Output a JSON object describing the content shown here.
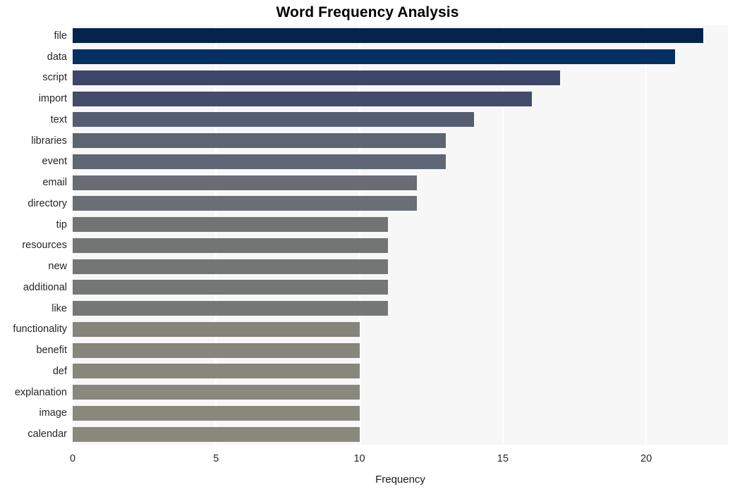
{
  "chart_data": {
    "type": "bar",
    "orientation": "horizontal",
    "title": "Word Frequency Analysis",
    "xlabel": "Frequency",
    "ylabel": "",
    "categories": [
      "file",
      "data",
      "script",
      "import",
      "text",
      "libraries",
      "event",
      "email",
      "directory",
      "tip",
      "resources",
      "new",
      "additional",
      "like",
      "functionality",
      "benefit",
      "def",
      "explanation",
      "image",
      "calendar"
    ],
    "values": [
      22,
      21,
      17,
      16,
      14,
      13,
      13,
      12,
      12,
      11,
      11,
      11,
      11,
      11,
      10,
      10,
      10,
      10,
      10,
      10
    ],
    "bar_colors": [
      "#04234d",
      "#032f63",
      "#3d4668",
      "#434c6b",
      "#555d72",
      "#5d6474",
      "#5f6675",
      "#696d73",
      "#6b6f74",
      "#727474",
      "#737575",
      "#747575",
      "#757676",
      "#767777",
      "#85857b",
      "#86867c",
      "#87877c",
      "#88887d",
      "#88887d",
      "#88887d"
    ],
    "xlim": [
      0,
      22.85
    ],
    "xticks": [
      0,
      5,
      10,
      15,
      20
    ],
    "xtick_labels": [
      "0",
      "5",
      "10",
      "15",
      "20"
    ],
    "grid": "vertical-white",
    "plot_background": "#f7f7f7",
    "legend": "none"
  }
}
